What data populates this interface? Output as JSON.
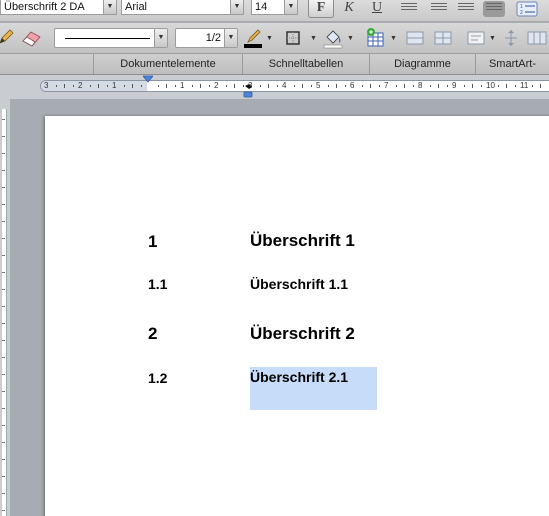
{
  "toolbar": {
    "style_value": "Überschrift 2 DA",
    "font_value": "Arial",
    "size_value": "14",
    "bold_label": "F",
    "italic_label": "K",
    "underline_label": "U",
    "line_weight_value": "1/2"
  },
  "ribbon": {
    "tabs": [
      "Dokumentelemente",
      "Schnelltabellen",
      "Diagramme",
      "SmartArt-"
    ]
  },
  "ruler": {
    "labels": [
      "3",
      "2",
      "1",
      "1",
      "2",
      "3",
      "4",
      "5",
      "6",
      "7",
      "8",
      "9",
      "10",
      "11"
    ]
  },
  "document": {
    "headings": [
      {
        "number": "1",
        "text": "Überschrift 1",
        "level": 1
      },
      {
        "number": "1.1",
        "text": "Überschrift 1.1",
        "level": 2
      },
      {
        "number": "2",
        "text": "Überschrift 2",
        "level": 1
      },
      {
        "number": "1.2",
        "text": "Überschrift 2.1",
        "level": 2,
        "selected": true
      }
    ]
  },
  "colors": {
    "selection": "#c7dcf8",
    "page": "#ffffff",
    "workspace": "#a7acb2"
  }
}
